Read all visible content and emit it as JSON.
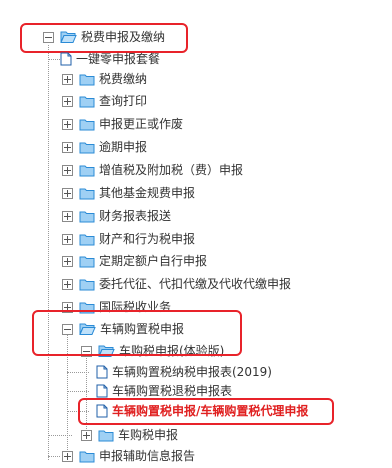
{
  "tree": {
    "root": {
      "label": "税费申报及缴纳",
      "state": "expanded"
    },
    "items": [
      {
        "label": "一键零申报套餐",
        "type": "file"
      },
      {
        "label": "税费缴纳",
        "type": "folder",
        "state": "collapsed"
      },
      {
        "label": "查询打印",
        "type": "folder",
        "state": "collapsed"
      },
      {
        "label": "申报更正或作废",
        "type": "folder",
        "state": "collapsed"
      },
      {
        "label": "逾期申报",
        "type": "folder",
        "state": "collapsed"
      },
      {
        "label": "增值税及附加税（费）申报",
        "type": "folder",
        "state": "collapsed"
      },
      {
        "label": "其他基金规费申报",
        "type": "folder",
        "state": "collapsed"
      },
      {
        "label": "财务报表报送",
        "type": "folder",
        "state": "collapsed"
      },
      {
        "label": "财产和行为税申报",
        "type": "folder",
        "state": "collapsed"
      },
      {
        "label": "定期定额户自行申报",
        "type": "folder",
        "state": "collapsed"
      },
      {
        "label": "委托代征、代扣代缴及代收代缴申报",
        "type": "folder",
        "state": "collapsed"
      },
      {
        "label": "国际税收业务",
        "type": "folder",
        "state": "collapsed"
      },
      {
        "label": "车辆购置税申报",
        "type": "folder",
        "state": "expanded"
      }
    ],
    "vehicle_children": [
      {
        "label": "车购税申报(体验版)",
        "type": "folder",
        "state": "expanded"
      }
    ],
    "trial_children": [
      {
        "label": "车辆购置税纳税申报表(2019)",
        "type": "file"
      },
      {
        "label": "车辆购置税退税申报表",
        "type": "file"
      },
      {
        "label": "车辆购置税申报/车辆购置税代理申报",
        "type": "file",
        "highlight": true
      }
    ],
    "vehicle_more": [
      {
        "label": "车购税申报",
        "type": "folder",
        "state": "collapsed"
      }
    ],
    "after": [
      {
        "label": "申报辅助信息报告",
        "type": "folder",
        "state": "collapsed"
      }
    ]
  },
  "colors": {
    "highlight_box": "#e8232a",
    "highlight_text": "#e02020",
    "folder": "#2b8bd6",
    "file": "#1f5fa8"
  }
}
